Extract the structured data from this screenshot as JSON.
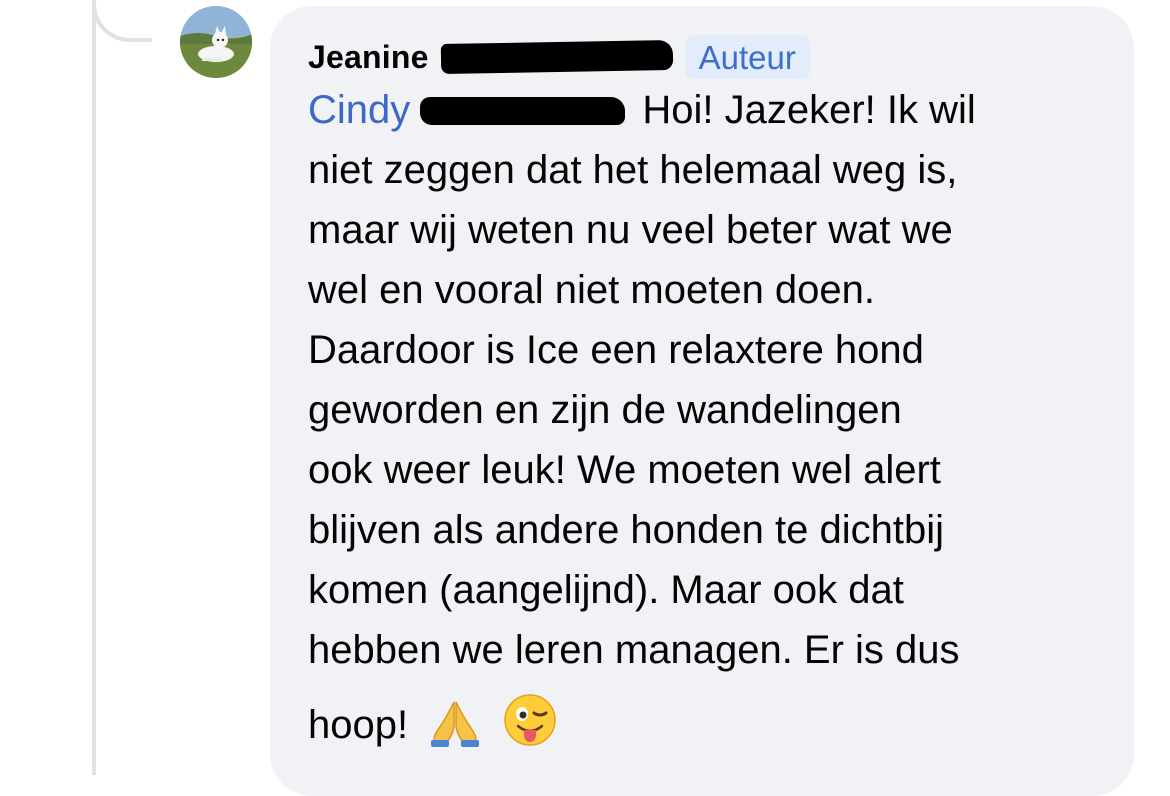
{
  "comment": {
    "author": {
      "first_name": "Jeanine",
      "badge": "Auteur",
      "avatar_icon": "dog-photo-avatar"
    },
    "mention": {
      "first_name": "Cindy"
    },
    "text_lines": [
      " Hoi! Jazeker! Ik wil",
      "niet zeggen dat het helemaal weg is,",
      "maar wij weten nu veel beter wat we",
      "wel en vooral niet moeten doen.",
      "Daardoor is Ice een relaxtere hond",
      "geworden en zijn de wandelingen",
      "ook weer leuk! We moeten wel alert",
      "blijven als andere honden te dichtbij",
      "komen (aangelijnd). Maar ook dat",
      "hebben we leren managen. Er is dus"
    ],
    "last_line": "hoop!",
    "emojis": [
      "folded-hands-icon",
      "winking-face-tongue-icon"
    ]
  },
  "colors": {
    "bubble": "#f0f2f5",
    "mention": "#3b69c5",
    "badge_bg": "#e3ecfa",
    "badge_text": "#3d6fc8"
  }
}
